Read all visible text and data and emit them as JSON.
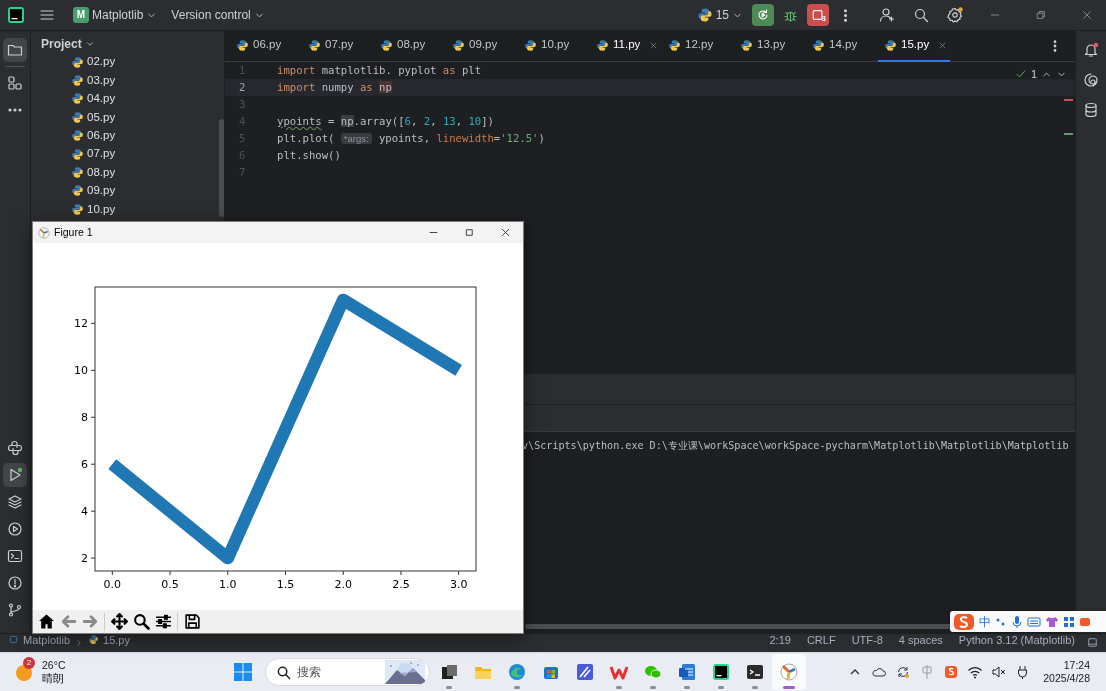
{
  "title_bar": {
    "project_badge": "M",
    "project": "Matplotlib",
    "vcs": "Version control",
    "run_config": "15",
    "stop_count": "3"
  },
  "left_toolbar": {
    "top": [
      {
        "kind": "folder",
        "selected": true
      },
      {
        "kind": "structure",
        "selected": false
      },
      {
        "kind": "more",
        "selected": false
      }
    ],
    "bottom": [
      {
        "kind": "console",
        "selected": false
      },
      {
        "kind": "run",
        "selected": true
      },
      {
        "kind": "layers",
        "selected": false
      },
      {
        "kind": "services",
        "selected": false
      },
      {
        "kind": "terminal",
        "selected": false
      },
      {
        "kind": "problems",
        "selected": false
      },
      {
        "kind": "git",
        "selected": false
      }
    ]
  },
  "project_panel": {
    "title": "Project",
    "files": [
      "02.py",
      "03.py",
      "04.py",
      "05.py",
      "06.py",
      "07.py",
      "08.py",
      "09.py",
      "10.py"
    ]
  },
  "tabs": [
    {
      "label": "06.py",
      "selected": false,
      "closable": false
    },
    {
      "label": "07.py",
      "selected": false,
      "closable": false
    },
    {
      "label": "08.py",
      "selected": false,
      "closable": false
    },
    {
      "label": "09.py",
      "selected": false,
      "closable": false
    },
    {
      "label": "10.py",
      "selected": false,
      "closable": false
    },
    {
      "label": "11.py",
      "selected": false,
      "closable": true
    },
    {
      "label": "12.py",
      "selected": false,
      "closable": false
    },
    {
      "label": "13.py",
      "selected": false,
      "closable": false
    },
    {
      "label": "14.py",
      "selected": false,
      "closable": false
    },
    {
      "label": "15.py",
      "selected": true,
      "closable": true
    }
  ],
  "editor": {
    "inspection_count": "1",
    "lines": [
      {
        "number": "1",
        "current": false,
        "tokens": [
          {
            "text": "import",
            "kind": "keyword"
          },
          {
            "text": " matplotlib. pyplot ",
            "kind": "name"
          },
          {
            "text": "as",
            "kind": "keyword"
          },
          {
            "text": " plt",
            "kind": "name"
          }
        ]
      },
      {
        "number": "2",
        "current": true,
        "tokens": [
          {
            "text": "import",
            "kind": "keyword"
          },
          {
            "text": " numpy ",
            "kind": "name"
          },
          {
            "text": "as ",
            "kind": "keyword"
          },
          {
            "text": "np",
            "kind": "definition"
          }
        ]
      },
      {
        "number": "3",
        "current": false
      },
      {
        "number": "4",
        "current": false,
        "tokens": [
          {
            "text": "ypoints",
            "kind": "name",
            "warning": true
          },
          {
            "text": " = ",
            "kind": "name"
          },
          {
            "text": "np",
            "kind": "reference"
          },
          {
            "text": ".array([",
            "kind": "name"
          },
          {
            "text": "6",
            "kind": "number"
          },
          {
            "text": ", ",
            "kind": "name"
          },
          {
            "text": "2",
            "kind": "number"
          },
          {
            "text": ", ",
            "kind": "name"
          },
          {
            "text": "13",
            "kind": "number"
          },
          {
            "text": ", ",
            "kind": "name"
          },
          {
            "text": "10",
            "kind": "number"
          },
          {
            "text": "])",
            "kind": "name"
          }
        ]
      },
      {
        "number": "5",
        "current": false,
        "tokens": [
          {
            "text": "plt.plot( ",
            "kind": "name"
          },
          {
            "text": "*args:",
            "kind": "hint"
          },
          {
            "text": " ypoints, ",
            "kind": "name"
          },
          {
            "text": "linewidth",
            "kind": "argument"
          },
          {
            "text": "=",
            "kind": "name"
          },
          {
            "text": "'12.5'",
            "kind": "string"
          },
          {
            "text": ")",
            "kind": "name"
          }
        ]
      },
      {
        "number": "6",
        "current": false,
        "tokens": [
          {
            "text": "plt.show()",
            "kind": "name"
          }
        ]
      },
      {
        "number": "7",
        "current": false
      }
    ]
  },
  "run_output": {
    "text": "v\\Scripts\\python.exe D:\\专业课\\workSpace\\workSpace-pycharm\\Matplotlib\\Matplotlib\\Matplotlib"
  },
  "right_toolbar": [
    {
      "kind": "notifications"
    },
    {
      "kind": "ai"
    },
    {
      "kind": "database"
    }
  ],
  "figure": {
    "title": "Figure 1",
    "chart_data": {
      "type": "line",
      "x": [
        0,
        1,
        2,
        3
      ],
      "series": [
        {
          "color": "#1f77b4",
          "values": [
            6,
            2,
            13,
            10
          ]
        }
      ],
      "xlim": [
        -0.15,
        3.15
      ],
      "ylim": [
        1.45,
        13.55
      ],
      "xticks": [
        {
          "value": 0,
          "label": "0.0"
        },
        {
          "value": 0.5,
          "label": "0.5"
        },
        {
          "value": 1,
          "label": "1.0"
        },
        {
          "value": 1.5,
          "label": "1.5"
        },
        {
          "value": 2,
          "label": "2.0"
        },
        {
          "value": 2.5,
          "label": "2.5"
        },
        {
          "value": 3,
          "label": "3.0"
        }
      ],
      "yticks": [
        2,
        4,
        6,
        8,
        10,
        12
      ]
    },
    "toolbar": [
      {
        "kind": "home",
        "disabled": false
      },
      {
        "kind": "back",
        "disabled": true
      },
      {
        "kind": "forward",
        "disabled": true
      },
      {
        "kind": "move",
        "disabled": false
      },
      {
        "kind": "zoom",
        "disabled": false
      },
      {
        "kind": "sliders",
        "disabled": false
      },
      {
        "kind": "save",
        "disabled": false
      }
    ]
  },
  "status_bar": {
    "breadcrumbs": [
      "Matplotlib",
      "15.py"
    ],
    "items": [
      "2:19",
      "CRLF",
      "UTF-8",
      "4 spaces",
      "Python 3.12 (Matplotlib)"
    ]
  },
  "ime_bar": {
    "mode": "中"
  },
  "taskbar": {
    "weather": {
      "badge": "2",
      "temperature": "26°C",
      "condition": "晴朗"
    },
    "search_placeholder": "搜索",
    "apps": [
      {
        "kind": "task-view",
        "running": true,
        "active": false
      },
      {
        "kind": "explorer",
        "running": false,
        "active": false
      },
      {
        "kind": "edge",
        "running": true,
        "active": false
      },
      {
        "kind": "store",
        "running": false,
        "active": false
      },
      {
        "kind": "draw",
        "running": false,
        "active": false
      },
      {
        "kind": "wps",
        "running": true,
        "active": false
      },
      {
        "kind": "wechat",
        "running": true,
        "active": false
      },
      {
        "kind": "word",
        "running": true,
        "active": false
      },
      {
        "kind": "pycharm",
        "running": true,
        "active": false
      },
      {
        "kind": "terminal",
        "running": true,
        "active": false
      },
      {
        "kind": "figure",
        "running": true,
        "active": true
      }
    ],
    "tray": [
      {
        "kind": "chevron"
      },
      {
        "kind": "cloud"
      },
      {
        "kind": "sync"
      },
      {
        "kind": "ime-status"
      },
      {
        "kind": "ime"
      },
      {
        "kind": "wifi"
      },
      {
        "kind": "mute"
      },
      {
        "kind": "power"
      }
    ],
    "time": "17:24",
    "date": "2025/4/28"
  }
}
